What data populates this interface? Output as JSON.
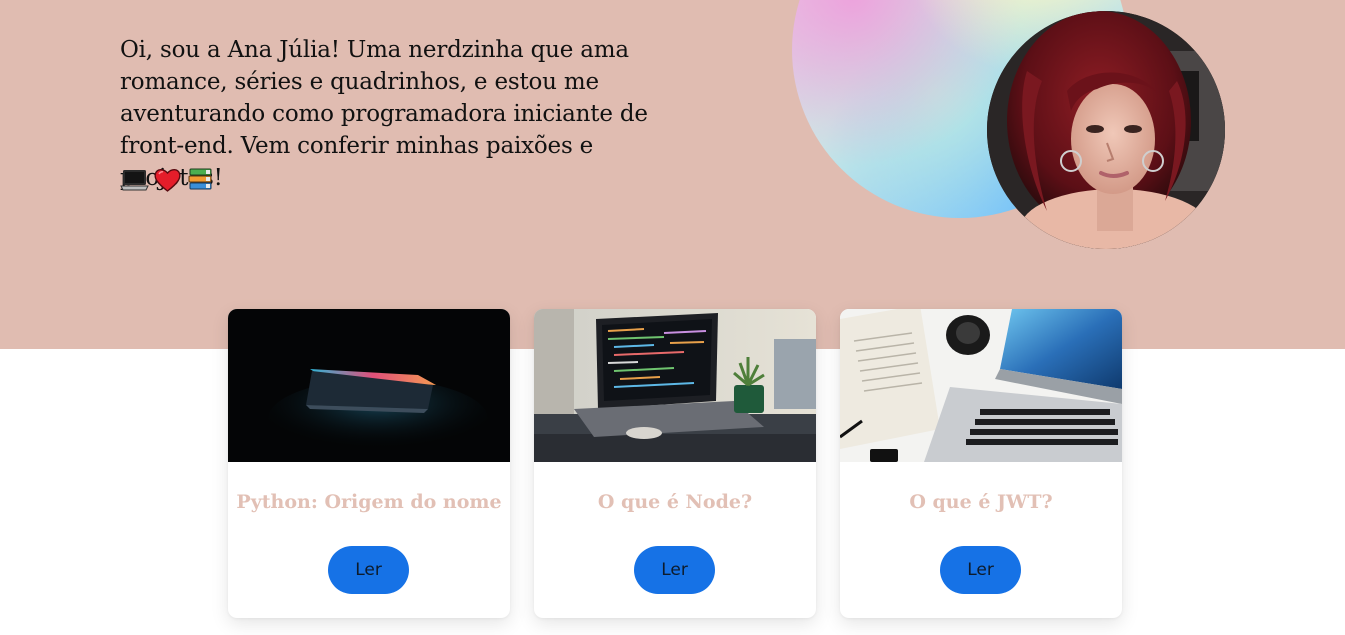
{
  "hero": {
    "intro_text": "Oi, sou a Ana Júlia! Uma nerdzinha que ama romance, séries e quadrinhos, e estou me aventurando como programadora iniciante de front-end. Vem conferir minhas paixões e projetos!",
    "emojis": [
      "laptop-icon",
      "heart-icon",
      "books-icon"
    ],
    "avatar": "profile-photo"
  },
  "cards": [
    {
      "title": "Python: Origem do nome",
      "button_label": "Ler",
      "image": "laptop-dark-glow-photo"
    },
    {
      "title": "O que é Node?",
      "button_label": "Ler",
      "image": "laptop-code-desk-photo"
    },
    {
      "title": "O que é JWT?",
      "button_label": "Ler",
      "image": "laptop-book-camera-photo"
    }
  ],
  "colors": {
    "hero_background": "#e0bcb1",
    "card_title": "#e2c0b5",
    "button": "#1672e6"
  }
}
